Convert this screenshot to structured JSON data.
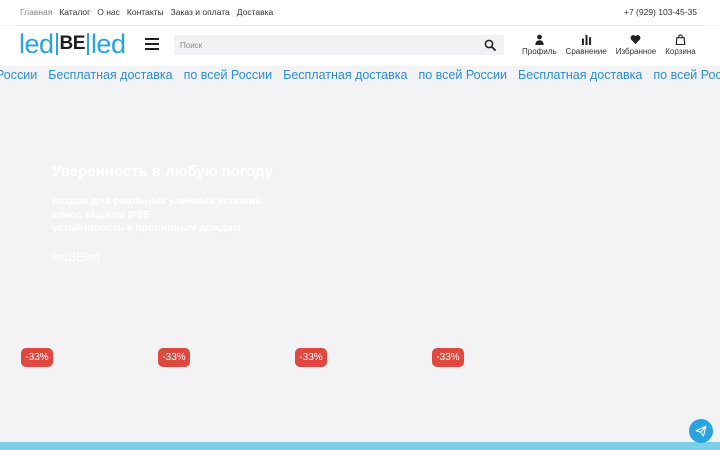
{
  "topnav": {
    "items": [
      "Главная",
      "Каталог",
      "О нас",
      "Контакты",
      "Заказ и оплата",
      "Доставка"
    ]
  },
  "contact": {
    "phone": "+7 (929) 103-45-35"
  },
  "brand": {
    "logo_left": "led",
    "logo_middle": "BE",
    "logo_right": "led",
    "color": "#2aa3df"
  },
  "search": {
    "placeholder": "Поиск"
  },
  "actions": [
    {
      "label": "Профиль",
      "icon": "user-icon"
    },
    {
      "label": "Сравнение",
      "icon": "compare-icon"
    },
    {
      "label": "Избранное",
      "icon": "heart-icon"
    },
    {
      "label": "Корзина",
      "icon": "bag-icon"
    }
  ],
  "marquee": {
    "items": [
      "России",
      "Бесплатная доставка",
      "по всей России",
      "Бесплатная доставка",
      "по всей России",
      "Бесплатная доставка",
      "по всей России"
    ]
  },
  "hero": {
    "title": "Уверенность в любую погоду",
    "line1": "создан для реальных уличных условий:",
    "line2": "класс защиты IP65",
    "line3": "устойчивость к проливным дождям",
    "brand": "ledBEled"
  },
  "badges": [
    "-33%",
    "-33%",
    "-33%",
    "-33%"
  ],
  "colors": {
    "accent": "#2aa3df",
    "badge": "#e0473f",
    "background": "#f3f3f6"
  }
}
